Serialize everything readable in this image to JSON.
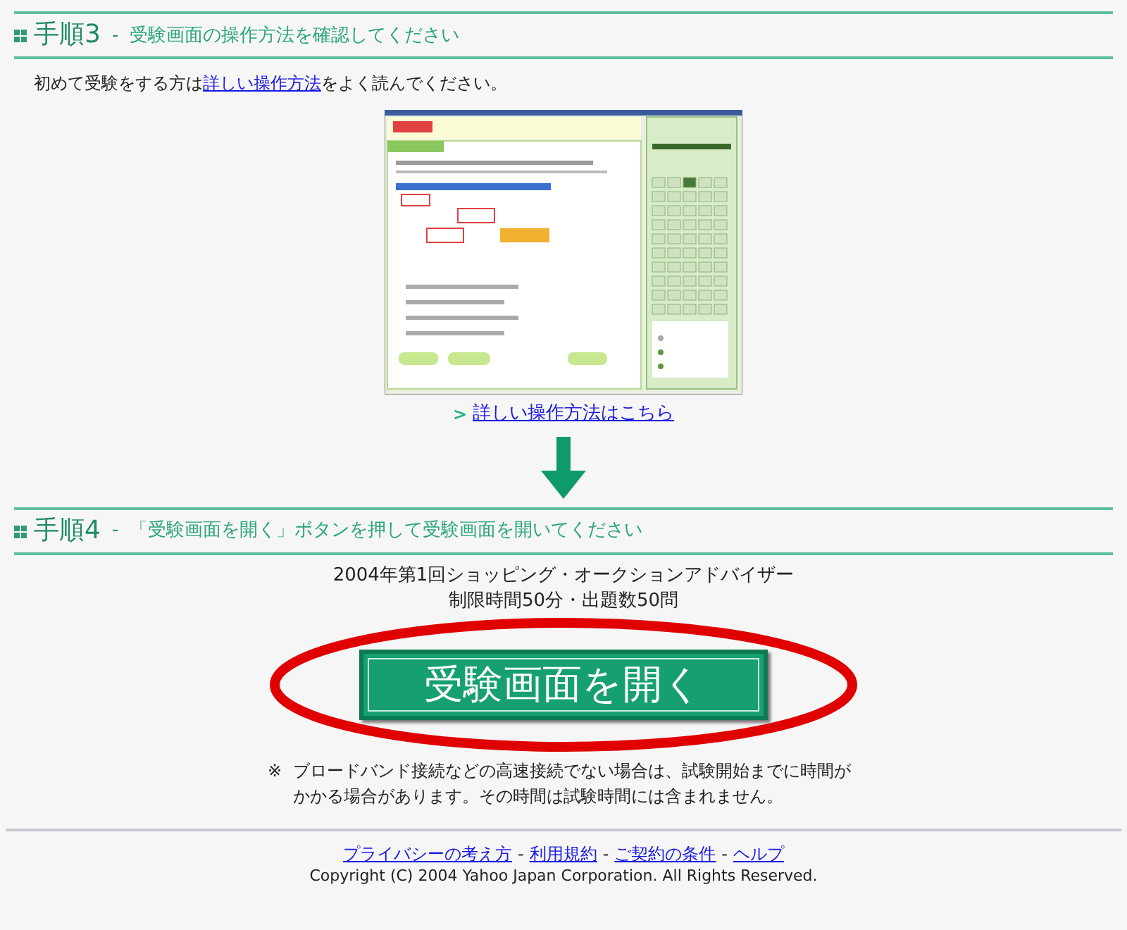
{
  "step3": {
    "number": "手順3",
    "separator": "-",
    "title": "受験画面の操作方法を確認してください"
  },
  "intro": {
    "before": "初めて受験をする方は",
    "link": "詳しい操作方法",
    "after": "をよく読んでください。"
  },
  "guide_link": {
    "arrow": ">",
    "label": "詳しい操作方法はこちら"
  },
  "step4": {
    "number": "手順4",
    "separator": "-",
    "title": "「受験画面を開く」ボタンを押して受験画面を開いてください"
  },
  "exam": {
    "name": "2004年第1回ショッピング・オークションアドバイザー",
    "details": "制限時間50分・出題数50問"
  },
  "open_button": {
    "label": "受験画面を開く"
  },
  "note": {
    "mark": "※",
    "text": "ブロードバンド接続などの高速接続でない場合は、試験開始までに時間がかかる場合があります。その時間は試験時間には含まれません。"
  },
  "footer": {
    "links": [
      "プライバシーの考え方",
      "利用規約",
      "ご契約の条件",
      "ヘルプ"
    ],
    "separator": "-",
    "copyright": "Copyright (C) 2004 Yahoo Japan Corporation. All Rights Reserved."
  }
}
